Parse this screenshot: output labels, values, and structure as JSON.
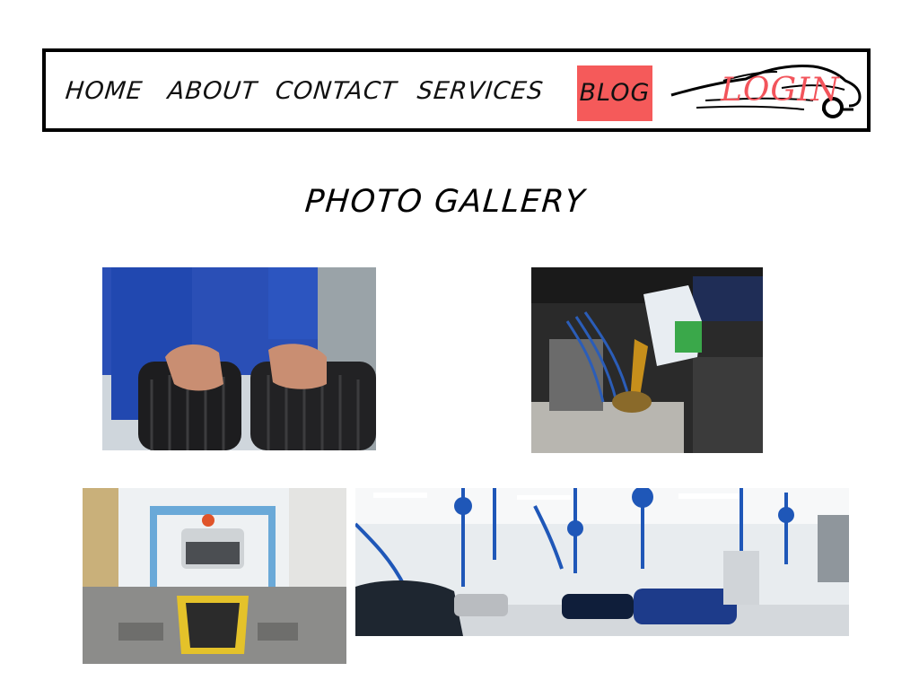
{
  "nav": {
    "items": [
      {
        "label": "HOME"
      },
      {
        "label": "ABOUT"
      },
      {
        "label": "CONTACT"
      },
      {
        "label": "SERVICES"
      }
    ],
    "active_label": "BLOG",
    "active_color": "#f55a5a",
    "login_label": "LOGIN",
    "login_color": "#f2545b"
  },
  "page": {
    "title": "PHOTO GALLERY"
  },
  "gallery": {
    "images": [
      {
        "icon": "tire-inspection-photo"
      },
      {
        "icon": "engine-oil-pour-photo"
      },
      {
        "icon": "inspection-pit-photo"
      },
      {
        "icon": "service-workshop-photo"
      }
    ]
  }
}
